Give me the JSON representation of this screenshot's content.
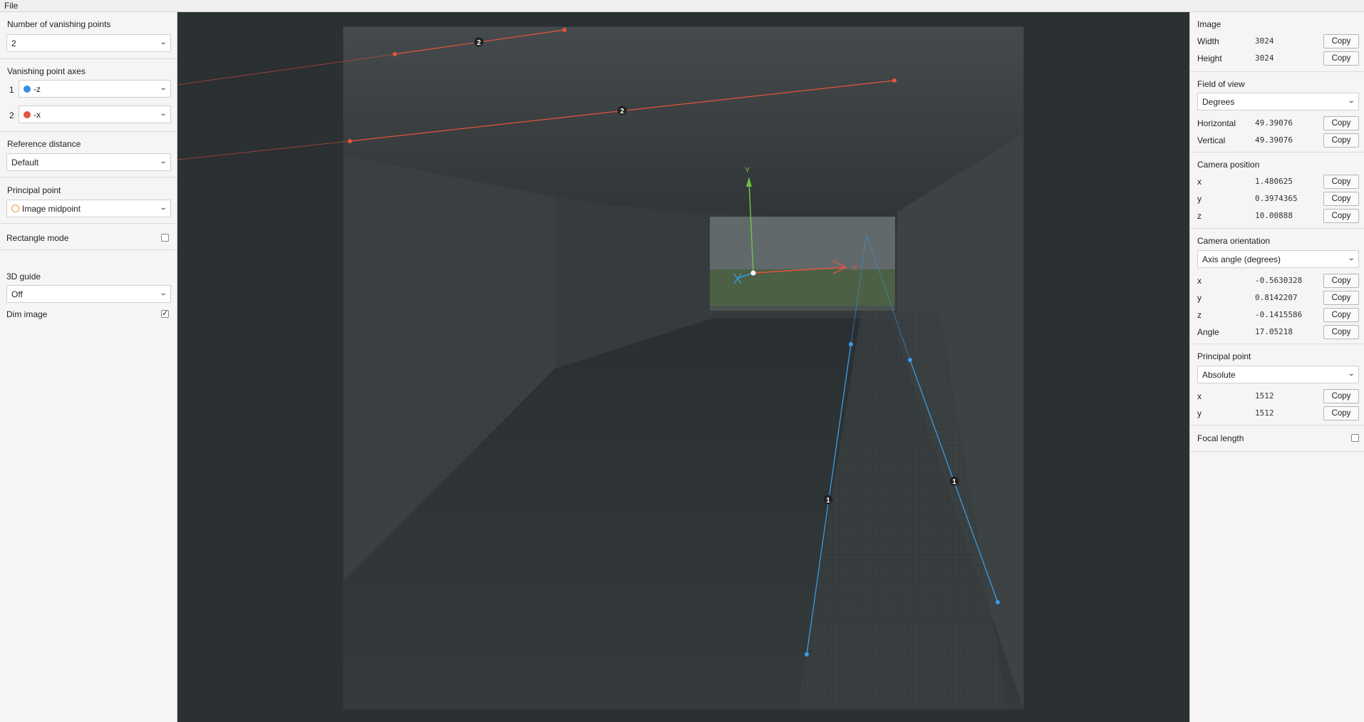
{
  "menubar": {
    "file": "File"
  },
  "left": {
    "num_vp": {
      "label": "Number of vanishing points",
      "value": "2"
    },
    "vp_axes": {
      "label": "Vanishing point axes",
      "rows": [
        {
          "index": "1",
          "color": "#3b8ee0",
          "value": "-z"
        },
        {
          "index": "2",
          "color": "#e5533d",
          "value": "-x"
        }
      ]
    },
    "ref_distance": {
      "label": "Reference distance",
      "value": "Default"
    },
    "principal_point": {
      "label": "Principal point",
      "value": "Image midpoint"
    },
    "rectangle_mode": {
      "label": "Rectangle mode",
      "checked": false
    },
    "guide": {
      "label": "3D guide",
      "value": "Off"
    },
    "dim_image": {
      "label": "Dim image",
      "checked": true
    }
  },
  "right": {
    "copy_label": "Copy",
    "image": {
      "title": "Image",
      "width_label": "Width",
      "width": "3024",
      "height_label": "Height",
      "height": "3024"
    },
    "fov": {
      "title": "Field of view",
      "unit": "Degrees",
      "h_label": "Horizontal",
      "h": "49.39076",
      "v_label": "Vertical",
      "v": "49.39076"
    },
    "camera_position": {
      "title": "Camera position",
      "x_label": "x",
      "x": "1.480625",
      "y_label": "y",
      "y": "0.3974365",
      "z_label": "z",
      "z": "10.00888"
    },
    "camera_orientation": {
      "title": "Camera orientation",
      "mode": "Axis angle (degrees)",
      "x_label": "x",
      "x": "-0.5630328",
      "y_label": "y",
      "y": "0.8142207",
      "z_label": "z",
      "z": "-0.1415586",
      "angle_label": "Angle",
      "angle": "17.05218"
    },
    "principal_point": {
      "title": "Principal point",
      "mode": "Absolute",
      "x_label": "x",
      "x": "1512",
      "y_label": "y",
      "y": "1512"
    },
    "focal_length": {
      "title": "Focal length",
      "checked": false
    }
  },
  "canvas": {
    "vp1_marker": "1",
    "vp2_marker": "2",
    "axis_x_label": "X",
    "axis_y_label": "Y",
    "colors": {
      "vp1": "#3b9be8",
      "vp2": "#e5533d",
      "axis_x": "#e5533d",
      "axis_y": "#6cc04a",
      "axis_z": "#3b9be8"
    }
  }
}
